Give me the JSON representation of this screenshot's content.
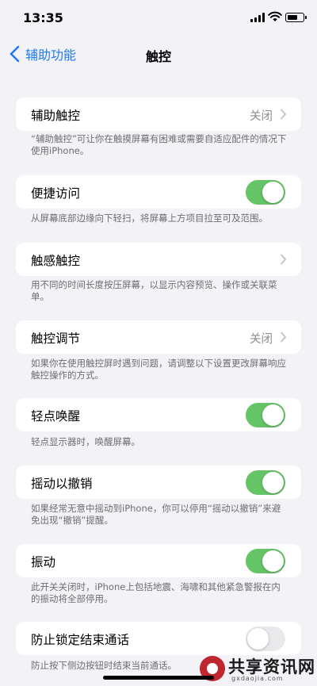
{
  "status_bar": {
    "time": "13:35",
    "battery_level": 0.7
  },
  "nav": {
    "back_label": "辅助功能",
    "title": "触控"
  },
  "items": [
    {
      "label": "辅助触控",
      "value": "关闭",
      "footer": "“辅助触控”可让你在触摸屏幕有困难或需要自适应配件的情况下使用iPhone。"
    },
    {
      "label": "便捷访问",
      "toggle": true,
      "footer": "从屏幕底部边缘向下轻扫，将屏幕上方项目拉至可及范围。"
    },
    {
      "label": "触感触控",
      "footer": "用不同的时间长度按压屏幕，以显示内容预览、操作或关联菜单。"
    },
    {
      "label": "触控调节",
      "value": "关闭",
      "footer": "如果你在使用触控屏时遇到问题，请调整以下设置更改屏幕响应触控操作的方式。"
    },
    {
      "label": "轻点唤醒",
      "toggle": true,
      "footer": "轻点显示器时，唤醒屏幕。"
    },
    {
      "label": "摇动以撤销",
      "toggle": true,
      "footer": "如果经常无意中摇动到iPhone，你可以停用“摇动以撤销”来避免出现“撤销”提醒。"
    },
    {
      "label": "振动",
      "toggle": true,
      "footer": "此开关关闭时，iPhone上包括地震、海啸和其他紧急警报在内的振动将全部停用。"
    },
    {
      "label": "防止锁定结束通话",
      "toggle": false,
      "footer": "防止按下侧边按钮时结束当前通话。"
    }
  ],
  "watermark": {
    "title": "共享资讯网",
    "subtitle": "gxdaojia.com"
  },
  "colors": {
    "accent": "#1f7cf5",
    "toggle_on": "#65c466",
    "toggle_off": "#e9e9eb",
    "background": "#f2f2f7"
  }
}
